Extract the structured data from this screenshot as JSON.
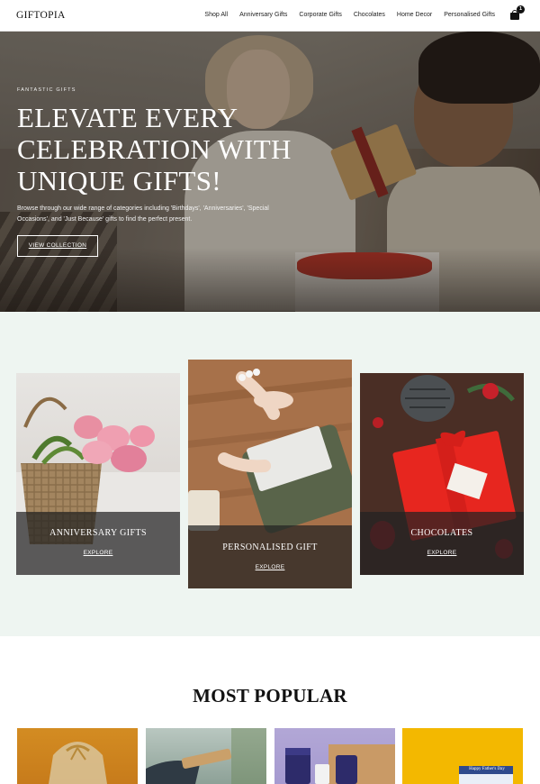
{
  "header": {
    "logo": "GIFTOPIA",
    "nav": [
      "Shop All",
      "Anniversary Gifts",
      "Corporate Gifts",
      "Chocolates",
      "Home Decor",
      "Personalised Gifts"
    ],
    "cart_count": "1",
    "cart_icon": "shopping-bag-icon"
  },
  "hero": {
    "eyebrow": "FANTASTIC GIFTS",
    "title_lines": [
      "ELEVATE EVERY",
      "CELEBRATION WITH",
      "UNIQUE GIFTS!"
    ],
    "description": "Browse through our wide range of categories including 'Birthdays', 'Anniversaries', 'Special Occasions', and 'Just Because' gifts to find the perfect present.",
    "button": "VIEW COLLECTION"
  },
  "categories": [
    {
      "title": "ANNIVERSARY GIFTS",
      "link": "EXPLORE"
    },
    {
      "title": "PERSONALISED GIFT",
      "link": "EXPLORE"
    },
    {
      "title": "CHOCOLATES",
      "link": "EXPLORE"
    }
  ],
  "popular": {
    "title": "MOST POPULAR",
    "product4_label": "Happy Father's Day"
  },
  "colors": {
    "category_bg": "#eef5f1",
    "overlay": "#232323",
    "text_dark": "#111111"
  }
}
